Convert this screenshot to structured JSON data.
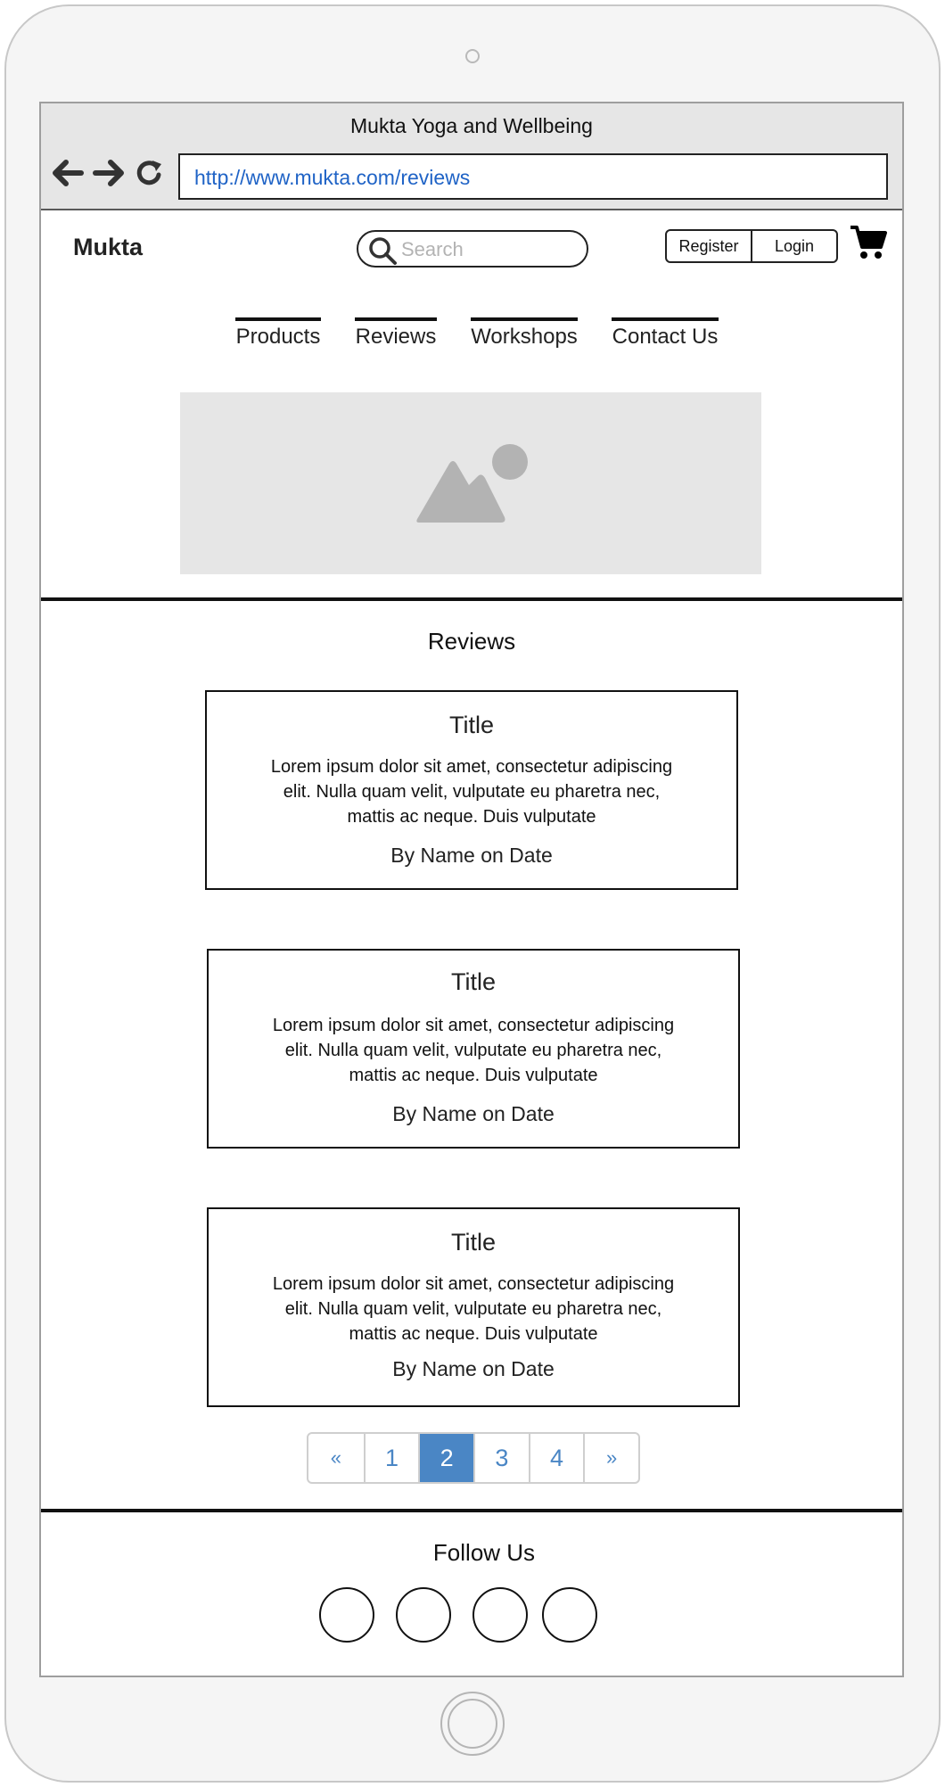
{
  "window": {
    "title": "Mukta Yoga and Wellbeing",
    "url": "http://www.mukta.com/reviews"
  },
  "header": {
    "brand": "Mukta",
    "search_placeholder": "Search",
    "register_label": "Register",
    "login_label": "Login"
  },
  "nav": {
    "items": [
      {
        "label": "Products"
      },
      {
        "label": "Reviews"
      },
      {
        "label": "Workshops"
      },
      {
        "label": "Contact Us"
      }
    ]
  },
  "reviews": {
    "heading": "Reviews",
    "items": [
      {
        "title": "Title",
        "body": "Lorem ipsum dolor sit amet, consectetur adipiscing elit. Nulla quam velit, vulputate eu pharetra nec, mattis ac neque. Duis vulputate",
        "byline": "By Name on Date"
      },
      {
        "title": "Title",
        "body": "Lorem ipsum dolor sit amet, consectetur adipiscing elit. Nulla quam velit, vulputate eu pharetra nec, mattis ac neque. Duis vulputate",
        "byline": "By Name on Date"
      },
      {
        "title": "Title",
        "body": "Lorem ipsum dolor sit amet, consectetur adipiscing elit. Nulla quam velit, vulputate eu pharetra nec, mattis ac neque. Duis vulputate",
        "byline": "By Name on Date"
      }
    ]
  },
  "pagination": {
    "prev": "«",
    "pages": [
      "1",
      "2",
      "3",
      "4"
    ],
    "next": "»",
    "current": "2"
  },
  "footer": {
    "heading": "Follow Us"
  },
  "icons": {
    "back": "arrow-left-icon",
    "forward": "arrow-right-icon",
    "reload": "reload-icon",
    "search": "search-icon",
    "cart": "cart-icon",
    "hero": "image-placeholder-icon"
  },
  "colors": {
    "link": "#1f63c6",
    "pager_active": "#4a86c5",
    "placeholder_bg": "#e6e6e6"
  }
}
